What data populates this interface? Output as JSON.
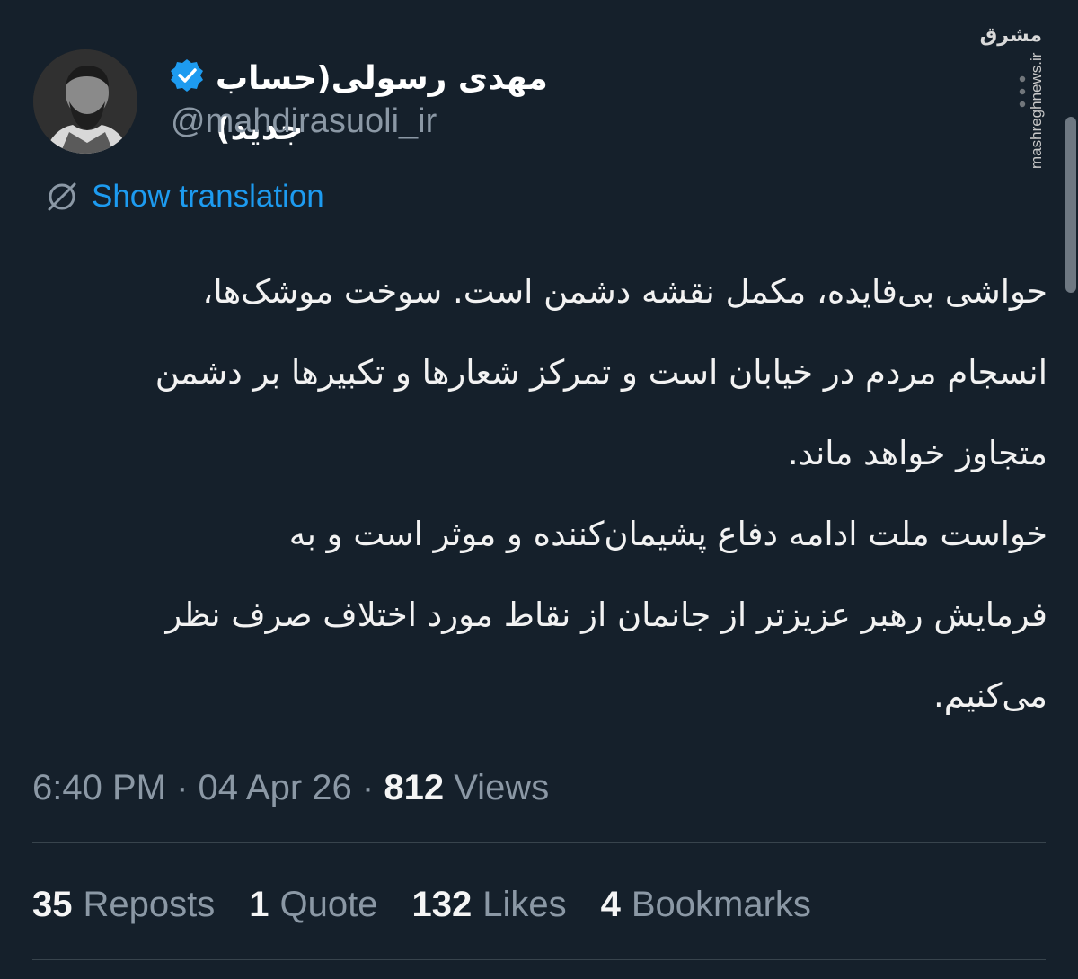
{
  "author": {
    "display_name": "مهدی رسولی(حساب جدید)",
    "handle": "@mahdirasuoli_ir"
  },
  "watermark": {
    "logo_text": "مشرق",
    "url": "mashreghnews.ir"
  },
  "translation": {
    "label": "Show translation"
  },
  "tweet": {
    "paragraphs": [
      "حواشی بی‌فایده، مکمل نقشه دشمن است. سوخت موشک‌ها،",
      "انسجام مردم در خیابان است و تمرکز شعارها و تکبیرها بر دشمن",
      "متجاوز خواهد ماند.",
      "خواست ملت ادامه دفاع پشیمان‌کننده و موثر است و به",
      "فرمایش رهبر عزیزتر از جانمان از نقاط مورد اختلاف صرف نظر",
      "می‌کنیم."
    ]
  },
  "meta": {
    "time": "6:40 PM",
    "date": "04 Apr 26",
    "views_count": "812",
    "views_label": "Views"
  },
  "stats": {
    "reposts": {
      "count": "35",
      "label": "Reposts"
    },
    "quotes": {
      "count": "1",
      "label": "Quote"
    },
    "likes": {
      "count": "132",
      "label": "Likes"
    },
    "bookmarks": {
      "count": "4",
      "label": "Bookmarks"
    }
  },
  "colors": {
    "background": "#15202b",
    "accent": "#1d9bf0",
    "muted": "#8b98a5"
  }
}
